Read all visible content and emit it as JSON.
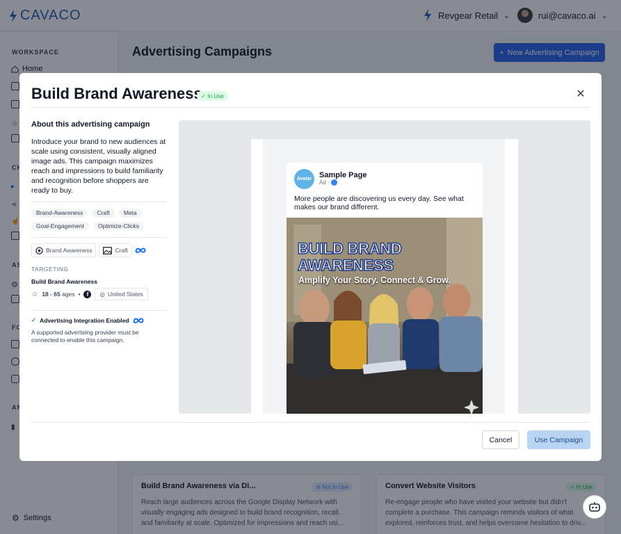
{
  "app": {
    "logo_text": "CAVACO",
    "org_name": "Revgear Retail",
    "user_email": "rui@cavaco.ai"
  },
  "sidebar": {
    "workspace_label": "WORKSPACE",
    "home_label": "Home",
    "section_labels": [
      "CH",
      "AS",
      "FO",
      "AN"
    ],
    "settings_label": "Settings"
  },
  "main": {
    "title": "Advertising Campaigns",
    "new_button_label": "New Advertising Campaign",
    "cards": [
      {
        "title": "Build Brand Awareness via Di...",
        "status": "Not In Use",
        "text": "Reach large audiences across the Google Display Network with visually engaging ads designed to build brand recognition, recall, and familiarity at scale. Optimized for impressions and reach usi..."
      },
      {
        "title": "Convert Website Visitors",
        "status": "In Use",
        "text": "Re-engage people who have visited your website but didn't complete a purchase. This campaign reminds visitors of what explored, reinforces trust, and helps overcome hesitation to driv..."
      }
    ]
  },
  "modal": {
    "title": "Build Brand Awareness",
    "status": "In Use",
    "about_heading": "About this advertising campaign",
    "about_text": "Introduce your brand to new audiences at scale using consistent, visually aligned image ads. This campaign maximizes reach and impressions to build familiarity and recognition before shoppers are ready to buy.",
    "tags": [
      "Brand-Awareness",
      "Craft",
      "Meta",
      "Goal-Engagement",
      "Optimize-Clicks"
    ],
    "tools": [
      {
        "label": "Brand Awareness",
        "icon": "target-icon"
      },
      {
        "label": "Craft",
        "icon": "image-icon"
      }
    ],
    "targeting": {
      "heading": "TARGETING",
      "name": "Build Brand Awareness",
      "age_range": "18 - 65",
      "age_unit": "ages",
      "location": "United States"
    },
    "integration": {
      "title": "Advertising Integration Enabled",
      "text": "A supported advertising provider must be connected to enable this campaign."
    },
    "preview": {
      "avatar_label": "Avatar",
      "page_name": "Sample Page",
      "ad_label": "Ad ·",
      "post_text": "More people are discovering us every day. See what makes our brand different.",
      "image_headline_1": "BUILD BRAND",
      "image_headline_2": "AWARENESS",
      "image_tagline": "Amplify Your Story. Connect & Grow."
    },
    "cancel_label": "Cancel",
    "use_label": "Use Campaign"
  },
  "colors": {
    "accent": "#2563eb",
    "success": "#16a34a",
    "meta_blue": "#0866ff"
  }
}
